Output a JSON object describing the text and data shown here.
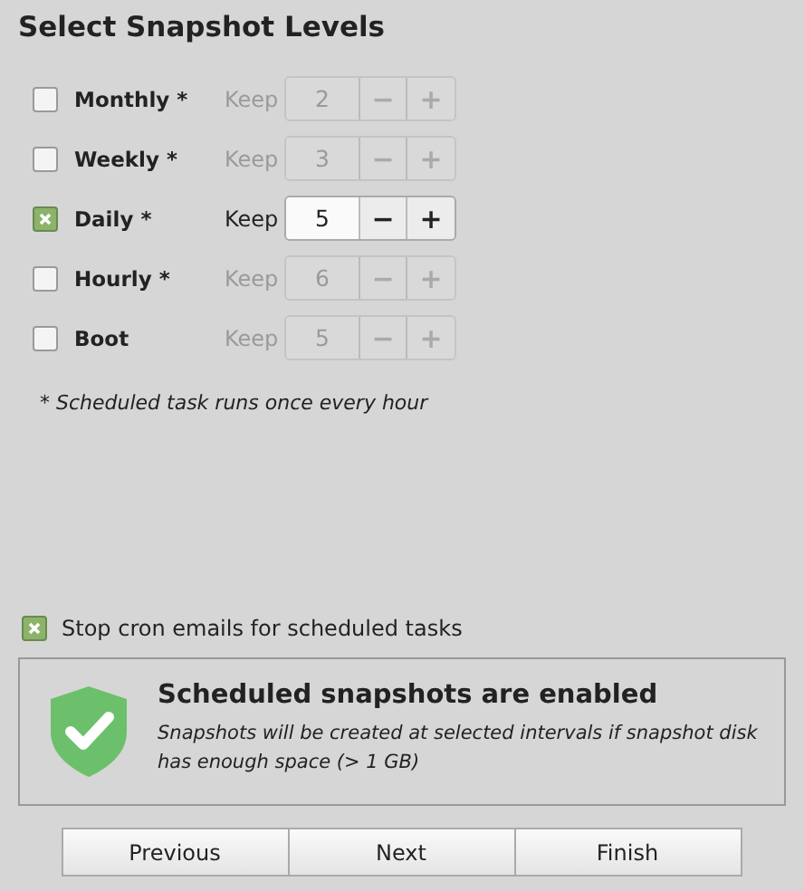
{
  "title": "Select Snapshot Levels",
  "levels": [
    {
      "label": "Monthly *",
      "checked": false,
      "keep_label": "Keep",
      "value": "2",
      "minus": "−",
      "plus": "+"
    },
    {
      "label": "Weekly *",
      "checked": false,
      "keep_label": "Keep",
      "value": "3",
      "minus": "−",
      "plus": "+"
    },
    {
      "label": "Daily *",
      "checked": true,
      "keep_label": "Keep",
      "value": "5",
      "minus": "−",
      "plus": "+"
    },
    {
      "label": "Hourly *",
      "checked": false,
      "keep_label": "Keep",
      "value": "6",
      "minus": "−",
      "plus": "+"
    },
    {
      "label": "Boot",
      "checked": false,
      "keep_label": "Keep",
      "value": "5",
      "minus": "−",
      "plus": "+"
    }
  ],
  "note": "* Scheduled task runs once every hour",
  "stop_cron": {
    "label": "Stop cron emails for scheduled tasks",
    "checked": true
  },
  "status": {
    "title": "Scheduled snapshots are enabled",
    "message": "Snapshots will be created at selected intervals if snapshot disk has enough space (> 1 GB)"
  },
  "buttons": [
    "Previous",
    "Next",
    "Finish"
  ]
}
